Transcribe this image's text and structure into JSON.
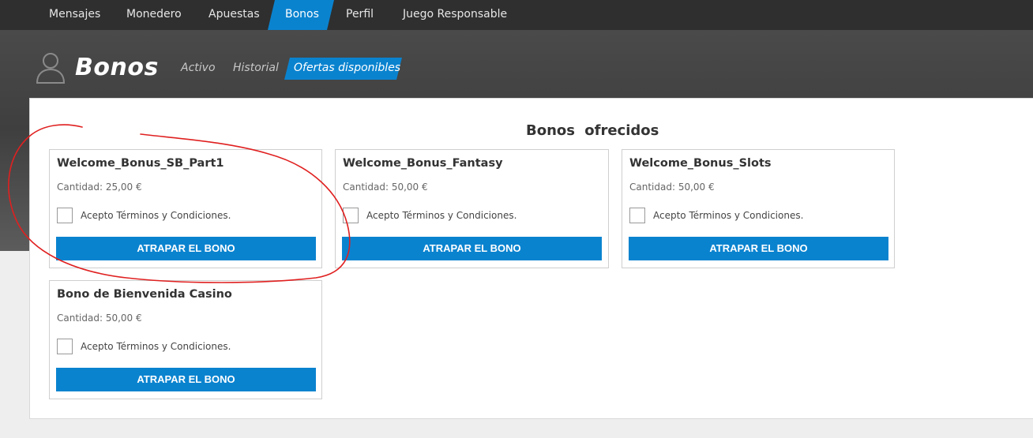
{
  "topnav": {
    "items": [
      {
        "label": "Mensajes"
      },
      {
        "label": "Monedero"
      },
      {
        "label": "Apuestas"
      },
      {
        "label": "Bonos"
      },
      {
        "label": "Perfil"
      },
      {
        "label": "Juego Responsable"
      }
    ],
    "active": "Bonos",
    "accent_color": "#0a83cf"
  },
  "header": {
    "icon": "user-icon",
    "title": "Bonos",
    "subtabs": [
      {
        "label": "Activo"
      },
      {
        "label": "Historial"
      },
      {
        "label": "Ofertas disponibles"
      }
    ],
    "active_subtab": "Ofertas disponibles"
  },
  "main": {
    "section_title": "Bonos  ofrecidos",
    "bonuses": [
      {
        "name": "Welcome_Bonus_SB_Part1",
        "amount": "Cantidad: 25,00 €",
        "terms": "Acepto Términos y Condiciones.",
        "button": "ATRAPAR EL BONO"
      },
      {
        "name": "Welcome_Bonus_Fantasy",
        "amount": "Cantidad: 50,00 €",
        "terms": "Acepto Términos y Condiciones.",
        "button": "ATRAPAR EL BONO"
      },
      {
        "name": "Welcome_Bonus_Slots",
        "amount": "Cantidad: 50,00 €",
        "terms": "Acepto Términos y Condiciones.",
        "button": "ATRAPAR EL BONO"
      },
      {
        "name": "Bono de Bienvenida Casino",
        "amount": "Cantidad: 50,00 €",
        "terms": "Acepto Términos y Condiciones.",
        "button": "ATRAPAR EL BONO"
      }
    ]
  },
  "annotation": {
    "color": "#e02020"
  }
}
